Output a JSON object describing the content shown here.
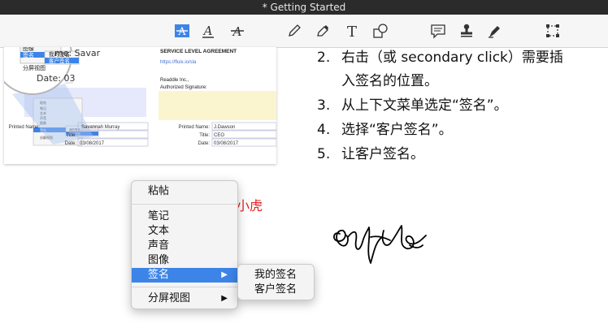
{
  "window": {
    "title": "* Getting Started"
  },
  "toolbar": {
    "tools": [
      {
        "name": "text-highlight-icon"
      },
      {
        "name": "text-underline-icon"
      },
      {
        "name": "text-strikethrough-icon"
      },
      {
        "name": "pencil-icon"
      },
      {
        "name": "eraser-icon"
      },
      {
        "name": "text-tool-icon"
      },
      {
        "name": "shapes-icon"
      },
      {
        "name": "note-icon"
      },
      {
        "name": "stamp-icon"
      },
      {
        "name": "signature-pen-icon"
      },
      {
        "name": "selection-icon"
      }
    ]
  },
  "document": {
    "heading": "SERVICE LEVEL AGREEMENT",
    "link": "https://fluix.io/sla",
    "company": "Readdle Inc.,",
    "authorized_label": "Authorized Signature:",
    "name_partial": "me: Savar",
    "date_partial": "Date: 03",
    "magnifier_menu": [
      "声音",
      "图像",
      "签名",
      "分屏视图"
    ],
    "magnifier_submenu": [
      "我的签名",
      "客户签名"
    ],
    "left_printed_name": "Printed Name:",
    "left_printed_value": "Savannah Murray",
    "left_title": "Title:",
    "left_date": "Date:",
    "left_date_value": "03/08/2017",
    "right_printed_name": "Printed Name:",
    "right_printed_value": "J.Dawson",
    "right_title": "Title:",
    "right_title_value": "CEO",
    "right_date": "Date:",
    "right_date_value": "03/08/2017"
  },
  "steps": [
    {
      "num": "2.",
      "text": "右击（或 secondary click）需要插"
    },
    {
      "num": "",
      "text": "入签名的位置。"
    },
    {
      "num": "3.",
      "text": "从上下文菜单选定“签名”。"
    },
    {
      "num": "4.",
      "text": "选择“客户签名”。"
    },
    {
      "num": "5.",
      "text": "让客户签名。"
    }
  ],
  "context_menu": {
    "items": [
      "粘帖",
      "笔记",
      "文本",
      "声音",
      "图像",
      "签名",
      "分屏视图"
    ],
    "selected": "签名",
    "submenu_arrow": "▶"
  },
  "submenu": {
    "items": [
      "我的签名",
      "客户签名"
    ]
  },
  "red_label": "乐小虎"
}
